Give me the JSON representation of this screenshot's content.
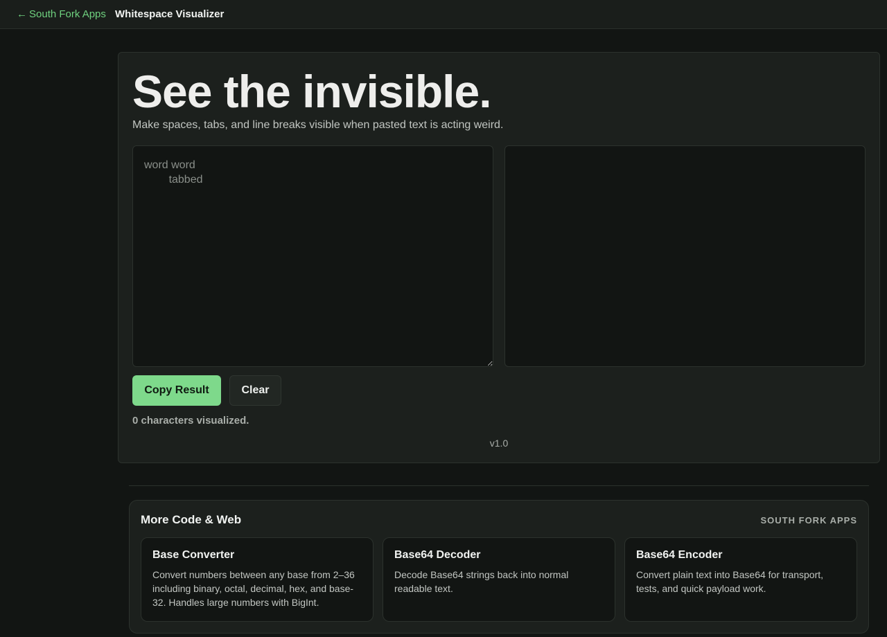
{
  "topbar": {
    "back_arrow": "←",
    "back_label": "South Fork Apps",
    "app_title": "Whitespace Visualizer"
  },
  "tool": {
    "hero_title": "See the invisible.",
    "subtitle": "Make spaces, tabs, and line breaks visible when pasted text is acting weird.",
    "input_placeholder": "word word\n\ttabbed",
    "input_value": "",
    "output_value": "",
    "copy_label": "Copy Result",
    "clear_label": "Clear",
    "status": "0 characters visualized.",
    "version": "v1.0"
  },
  "more": {
    "title": "More Code & Web",
    "brand": "SOUTH FORK APPS",
    "cards": [
      {
        "title": "Base Converter",
        "desc": "Convert numbers between any base from 2–36 including binary, octal, decimal, hex, and base-32. Handles large numbers with BigInt."
      },
      {
        "title": "Base64 Decoder",
        "desc": "Decode Base64 strings back into normal readable text."
      },
      {
        "title": "Base64 Encoder",
        "desc": "Convert plain text into Base64 for transport, tests, and quick payload work."
      }
    ]
  },
  "colors": {
    "accent": "#7ed98b",
    "background": "#121513",
    "panel": "#1c201d"
  }
}
